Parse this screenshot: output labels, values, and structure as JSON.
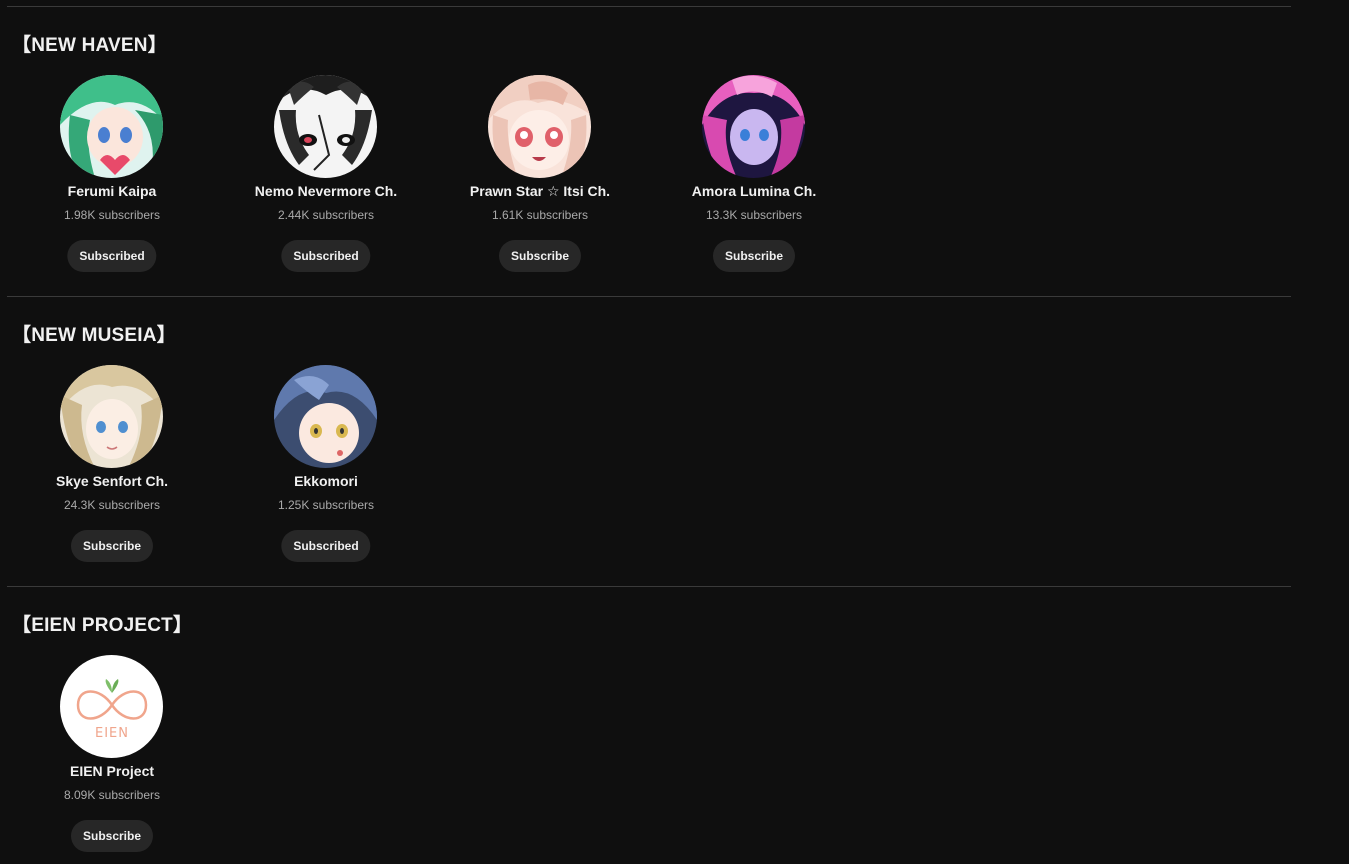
{
  "sections": [
    {
      "title": "【NEW HAVEN】",
      "channels": [
        {
          "name": "Ferumi Kaipa",
          "subscribers": "1.98K subscribers",
          "button": "Subscribed",
          "avatar_icon": "green-hair-vtuber-avatar",
          "avatar_colors": [
            "#cfe9e6",
            "#3fbf8a"
          ]
        },
        {
          "name": "Nemo Nevermore Ch.",
          "subscribers": "2.44K subscribers",
          "button": "Subscribed",
          "avatar_icon": "black-white-vtuber-avatar",
          "avatar_colors": [
            "#f2f2f2",
            "#222222"
          ]
        },
        {
          "name": "Prawn Star ☆ Itsi Ch.",
          "subscribers": "1.61K subscribers",
          "button": "Subscribe",
          "avatar_icon": "pink-hair-vtuber-avatar",
          "avatar_colors": [
            "#f7dcd3",
            "#e98a8a"
          ]
        },
        {
          "name": "Amora Lumina Ch.",
          "subscribers": "13.3K subscribers",
          "button": "Subscribe",
          "avatar_icon": "magenta-hair-vtuber-avatar",
          "avatar_colors": [
            "#2a1a4a",
            "#e85fbf"
          ]
        }
      ]
    },
    {
      "title": "【NEW MUSEIA】",
      "channels": [
        {
          "name": "Skye Senfort Ch.",
          "subscribers": "24.3K subscribers",
          "button": "Subscribe",
          "avatar_icon": "blonde-vtuber-avatar",
          "avatar_colors": [
            "#e8dfcf",
            "#c9b48a"
          ]
        },
        {
          "name": "Ekkomori",
          "subscribers": "1.25K subscribers",
          "button": "Subscribed",
          "avatar_icon": "blue-hair-vtuber-avatar",
          "avatar_colors": [
            "#3b4a6b",
            "#7b94c4"
          ]
        }
      ]
    },
    {
      "title": "【EIEN PROJECT】",
      "channels": [
        {
          "name": "EIEN Project",
          "subscribers": "8.09K subscribers",
          "button": "Subscribe",
          "avatar_icon": "eien-infinity-logo",
          "avatar_colors": [
            "#ffffff",
            "#f0a58c"
          ],
          "logo_text": "EIEN"
        }
      ]
    }
  ]
}
